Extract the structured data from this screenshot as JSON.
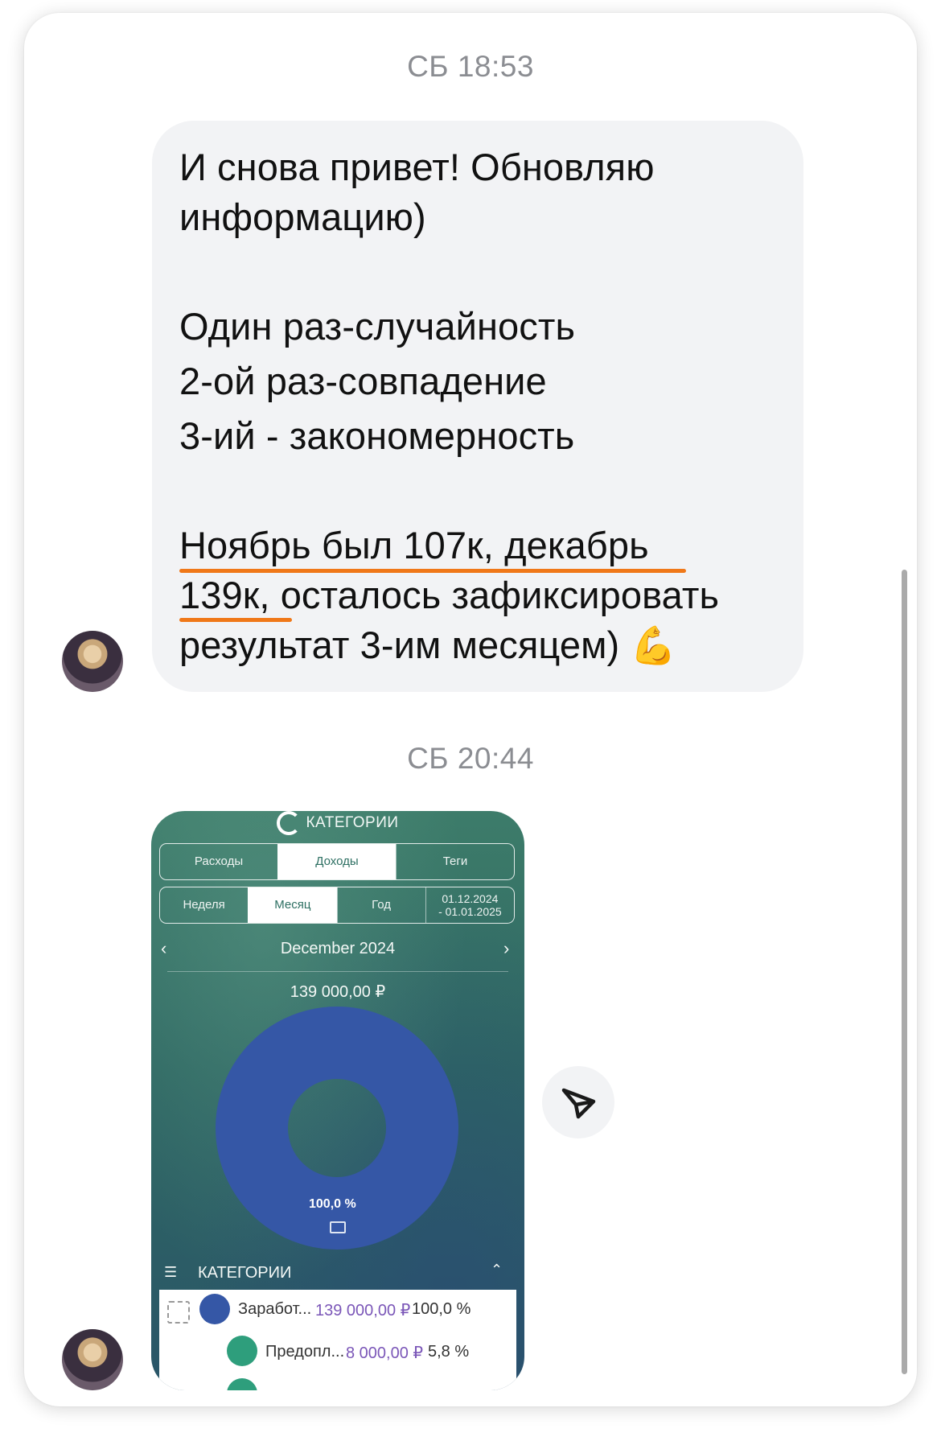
{
  "chat": {
    "timestamp_1": "СБ 18:53",
    "message_1": {
      "lines": [
        "И снова привет! Обновляю",
        "информацию)",
        "Один раз-случайность",
        "2-ой раз-совпадение",
        "3-ий - закономерность",
        "Ноябрь был 107к, декабрь",
        "139к, осталось зафиксировать",
        "результат 3-им месяцем)"
      ],
      "emoji": "💪"
    },
    "timestamp_2": "СБ 20:44"
  },
  "embedded_screenshot": {
    "title": "КАТЕГОРИИ",
    "tabs": [
      "Расходы",
      "Доходы",
      "Теги"
    ],
    "active_tab": "Доходы",
    "periods": [
      "Неделя",
      "Месяц",
      "Год"
    ],
    "active_period": "Месяц",
    "date_range_line1": "01.12.2024",
    "date_range_line2": "- 01.01.2025",
    "month": "December 2024",
    "total": "139 000,00 ₽",
    "donut_label": "100,0  %",
    "categories_header": "КАТЕГОРИИ",
    "rows": [
      {
        "name": "Заработ...",
        "amount": "139 000,00 ₽",
        "percent": "100,0 %"
      },
      {
        "name": "Предопл...",
        "amount": "8 000,00 ₽",
        "percent": "5,8 %"
      }
    ],
    "colors": {
      "donut": "#3557a6",
      "accent_purple": "#7b57b8",
      "row_icon_green": "#2e9e7c"
    }
  },
  "chart_data": {
    "type": "pie",
    "title": "",
    "categories": [
      "Заработ..."
    ],
    "values": [
      100.0
    ]
  }
}
